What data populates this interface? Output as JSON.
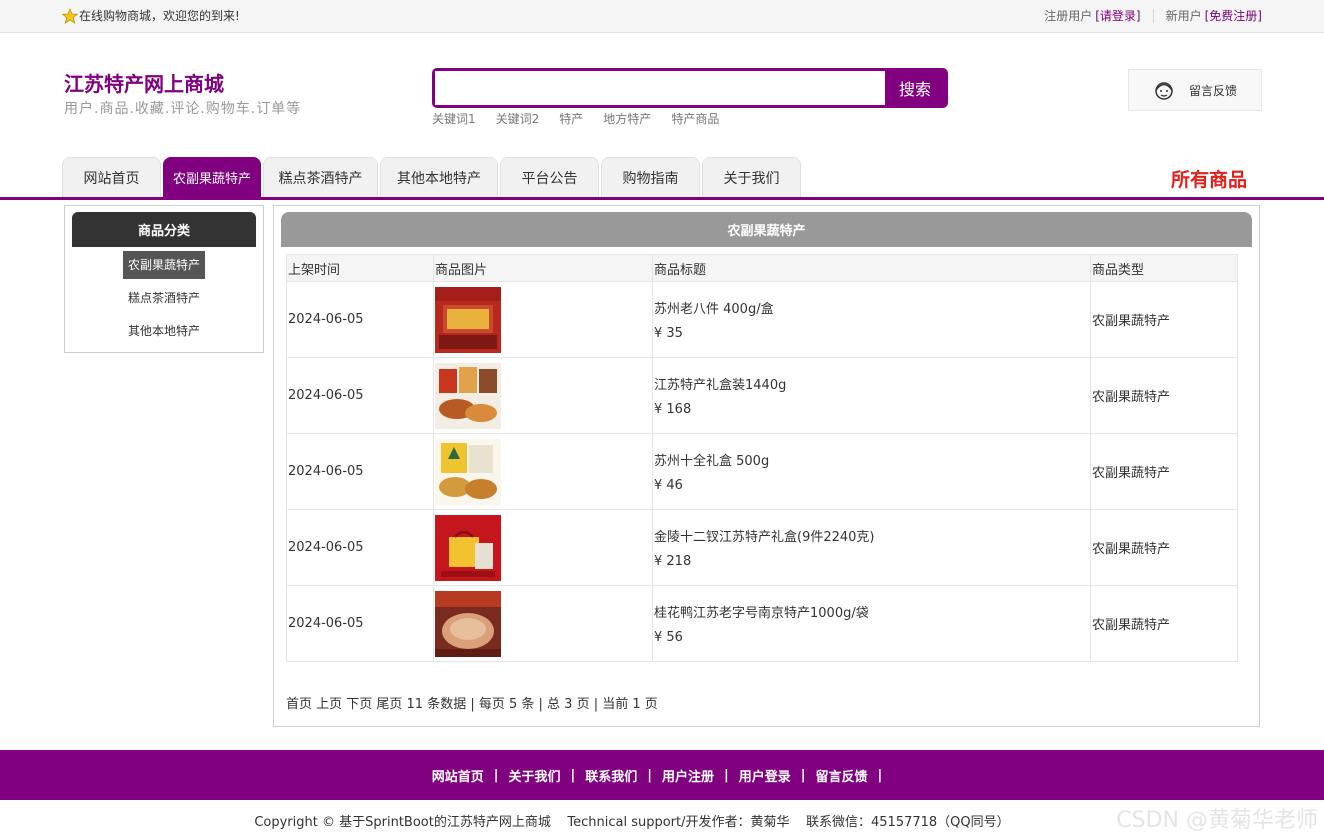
{
  "topbar": {
    "welcome": "在线购物商城，欢迎您的到来!",
    "registered_text": "注册用户",
    "login_link": "[请登录]",
    "new_user_text": "新用户",
    "register_link": "[免费注册]"
  },
  "header": {
    "site_title": "江苏特产网上商城",
    "subtitle": "用户.商品.收藏.评论.购物车.订单等",
    "search_placeholder": "",
    "search_button": "搜索",
    "keywords": [
      "关键词1",
      "关键词2",
      "特产",
      "地方特产",
      "特产商品"
    ],
    "feedback": "留言反馈"
  },
  "nav": {
    "tabs": [
      {
        "label": "网站首页",
        "active": false
      },
      {
        "label": "农副果蔬特产",
        "active": true
      },
      {
        "label": "糕点茶酒特产",
        "active": false
      },
      {
        "label": "其他本地特产",
        "active": false
      },
      {
        "label": "平台公告",
        "active": false
      },
      {
        "label": "购物指南",
        "active": false
      },
      {
        "label": "关于我们",
        "active": false
      }
    ],
    "all_goods": "所有商品"
  },
  "sidebar": {
    "title": "商品分类",
    "items": [
      {
        "label": "农副果蔬特产",
        "active": true
      },
      {
        "label": "糕点茶酒特产",
        "active": false
      },
      {
        "label": "其他本地特产",
        "active": false
      }
    ]
  },
  "main": {
    "title": "农副果蔬特产",
    "columns": [
      "上架时间",
      "商品图片",
      "商品标题",
      "商品类型"
    ],
    "rows": [
      {
        "date": "2024-06-05",
        "title": "苏州老八件 400g/盒",
        "price": "¥ 35",
        "type": "农副果蔬特产"
      },
      {
        "date": "2024-06-05",
        "title": "江苏特产礼盒装1440g",
        "price": "¥ 168",
        "type": "农副果蔬特产"
      },
      {
        "date": "2024-06-05",
        "title": "苏州十全礼盒 500g",
        "price": "¥ 46",
        "type": "农副果蔬特产"
      },
      {
        "date": "2024-06-05",
        "title": "金陵十二钗江苏特产礼盒(9件2240克)",
        "price": "¥ 218",
        "type": "农副果蔬特产"
      },
      {
        "date": "2024-06-05",
        "title": "桂花鸭江苏老字号南京特产1000g/袋",
        "price": "¥ 56",
        "type": "农副果蔬特产"
      }
    ],
    "pager": "首页 上页 下页 尾页 11 条数据 | 每页 5 条 | 总 3 页 | 当前 1 页"
  },
  "footer": {
    "links": [
      "网站首页",
      "关于我们",
      "联系我们",
      "用户注册",
      "用户登录",
      "留言反馈"
    ],
    "separator": "|",
    "copyright": "Copyright © 基于SprintBoot的江苏特产网上商城    Technical support/开发作者：黄菊华    联系微信：45157718（QQ同号）",
    "watermark": "CSDN @黄菊华老师"
  }
}
